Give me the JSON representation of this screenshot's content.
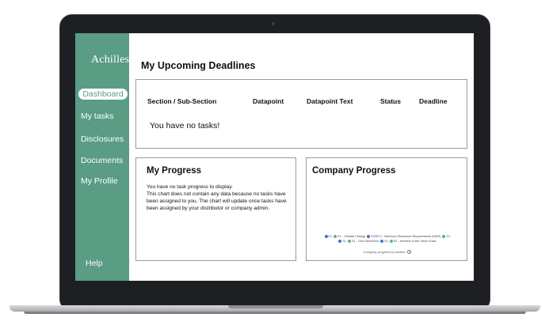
{
  "sidebar": {
    "logo": "Achilles",
    "items": [
      {
        "label": "Dashboard",
        "active": true
      },
      {
        "label": "My tasks",
        "active": false
      },
      {
        "label": "Disclosures",
        "active": false
      },
      {
        "label": "Documents",
        "active": false
      },
      {
        "label": "My Profile",
        "active": false
      }
    ],
    "help": "Help"
  },
  "main": {
    "title": "My Upcoming Deadlines",
    "deadlines": {
      "columns": [
        "Section / Sub-Section",
        "Datapoint",
        "Datapoint Text",
        "Status",
        "Deadline"
      ],
      "empty": "You have no tasks!"
    },
    "my_progress": {
      "title": "My Progress",
      "lines": [
        "You have no task progress to display.",
        "This chart does not contain any data because no tasks have been assigned to you. The chart will update once tasks have been assigned by your distributor or company admin."
      ]
    },
    "company_progress": {
      "title": "Company Progress",
      "legend": [
        {
          "label": "E1",
          "color": "#4472c4"
        },
        {
          "label": "E1 - Climate Change",
          "color": "#5ab08c"
        },
        {
          "label": "ESRS 2 - Minimum Disclosure Requirements (MDR)",
          "color": "#3e7cc0"
        },
        {
          "label": "G1",
          "color": "#5ab08c"
        },
        {
          "label": "S1",
          "color": "#4472c4"
        },
        {
          "label": "S1 - Own Workforce",
          "color": "#5ab08c"
        },
        {
          "label": "S2",
          "color": "#3e7cc0"
        },
        {
          "label": "S2 - Workers in the Value Chain",
          "color": "#5ab08c"
        }
      ],
      "caption": "Company progress by section"
    }
  },
  "colors": {
    "sidebar": "#5a9c84",
    "frame": "#1e1f22"
  }
}
